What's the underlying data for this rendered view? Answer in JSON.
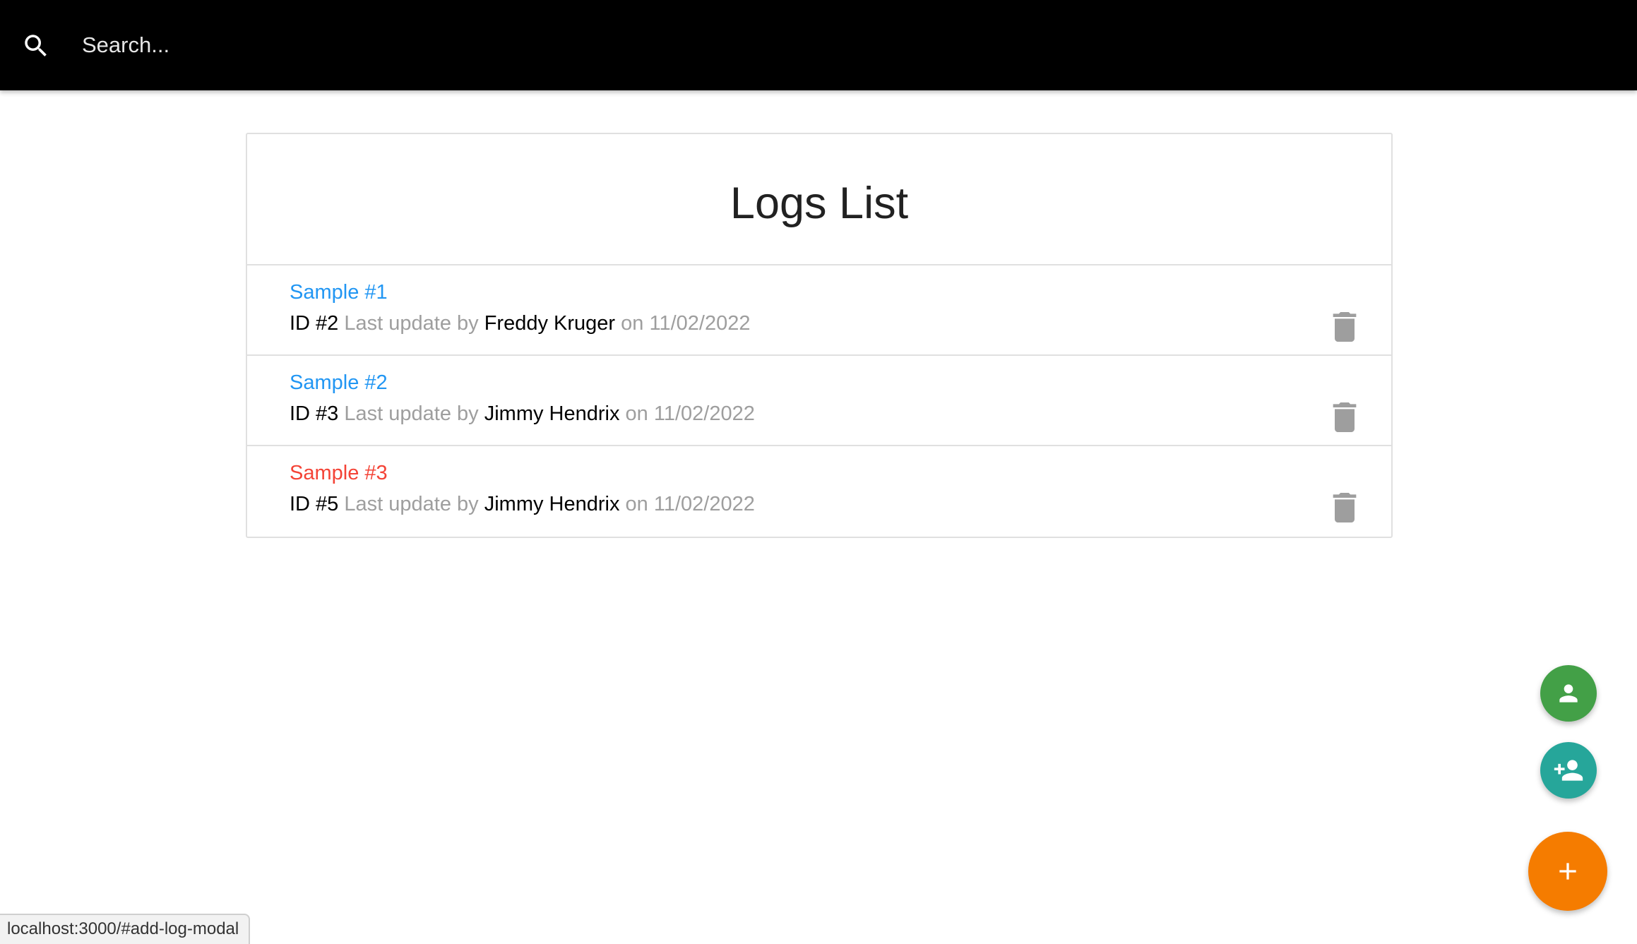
{
  "search": {
    "placeholder": "Search..."
  },
  "logs": {
    "title": "Logs List",
    "items": [
      {
        "title": "Sample #1",
        "id_label": "ID #2",
        "last_update_text": "Last update by",
        "tech": "Freddy Kruger",
        "on_text": "on",
        "date": "11/02/2022",
        "attention": false
      },
      {
        "title": "Sample #2",
        "id_label": "ID #3",
        "last_update_text": "Last update by",
        "tech": "Jimmy Hendrix",
        "on_text": "on",
        "date": "11/02/2022",
        "attention": false
      },
      {
        "title": "Sample #3",
        "id_label": "ID #5",
        "last_update_text": "Last update by",
        "tech": "Jimmy Hendrix",
        "on_text": "on",
        "date": "11/02/2022",
        "attention": true
      }
    ]
  },
  "fabs": {
    "users_icon": "person-icon",
    "add_user_icon": "person-add-icon",
    "add_log_icon": "add-icon"
  },
  "status_bar": {
    "url": "localhost:3000/#add-log-modal"
  },
  "colors": {
    "title_normal": "#2196f3",
    "title_attention": "#f44336",
    "fab_users": "#43a047",
    "fab_add_user": "#26a69a",
    "fab_add_log": "#f57c00"
  }
}
